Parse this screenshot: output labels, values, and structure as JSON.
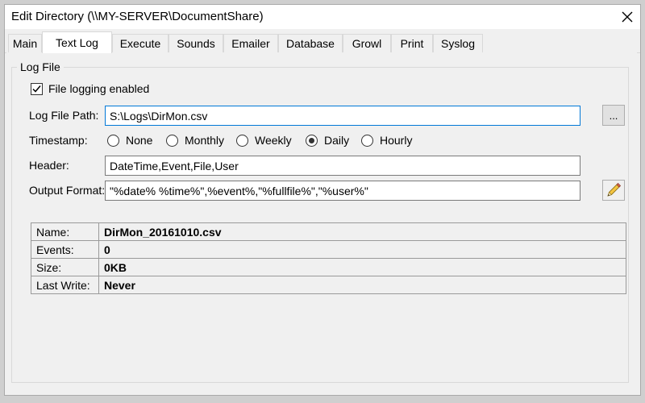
{
  "window": {
    "title": "Edit Directory (\\\\MY-SERVER\\DocumentShare)"
  },
  "tabs": [
    {
      "label": "Main",
      "active": false
    },
    {
      "label": "Text Log",
      "active": true
    },
    {
      "label": "Execute",
      "active": false
    },
    {
      "label": "Sounds",
      "active": false
    },
    {
      "label": "Emailer",
      "active": false
    },
    {
      "label": "Database",
      "active": false
    },
    {
      "label": "Growl",
      "active": false
    },
    {
      "label": "Print",
      "active": false
    },
    {
      "label": "Syslog",
      "active": false
    }
  ],
  "log_file": {
    "group_label": "Log File",
    "enabled_label": "File logging enabled",
    "enabled": true,
    "path_label": "Log File Path:",
    "path_value": "S:\\Logs\\DirMon.csv",
    "browse_label": "...",
    "timestamp_label": "Timestamp:",
    "timestamp_options": [
      "None",
      "Monthly",
      "Weekly",
      "Daily",
      "Hourly"
    ],
    "timestamp_selected": "Daily",
    "header_label": "Header:",
    "header_value": "DateTime,Event,File,User",
    "format_label": "Output Format:",
    "format_value": "\"%date% %time%\",%event%,\"%fullfile%\",\"%user%\"",
    "format_edit_icon": "pencil-icon"
  },
  "info": [
    {
      "key": "Name:",
      "value": "DirMon_20161010.csv"
    },
    {
      "key": "Events:",
      "value": "0"
    },
    {
      "key": "Size:",
      "value": "0KB"
    },
    {
      "key": "Last Write:",
      "value": "Never"
    }
  ],
  "colors": {
    "focus_border": "#0078d7",
    "window_bg": "#f0f0f0",
    "pencil": "#e86a4f"
  }
}
